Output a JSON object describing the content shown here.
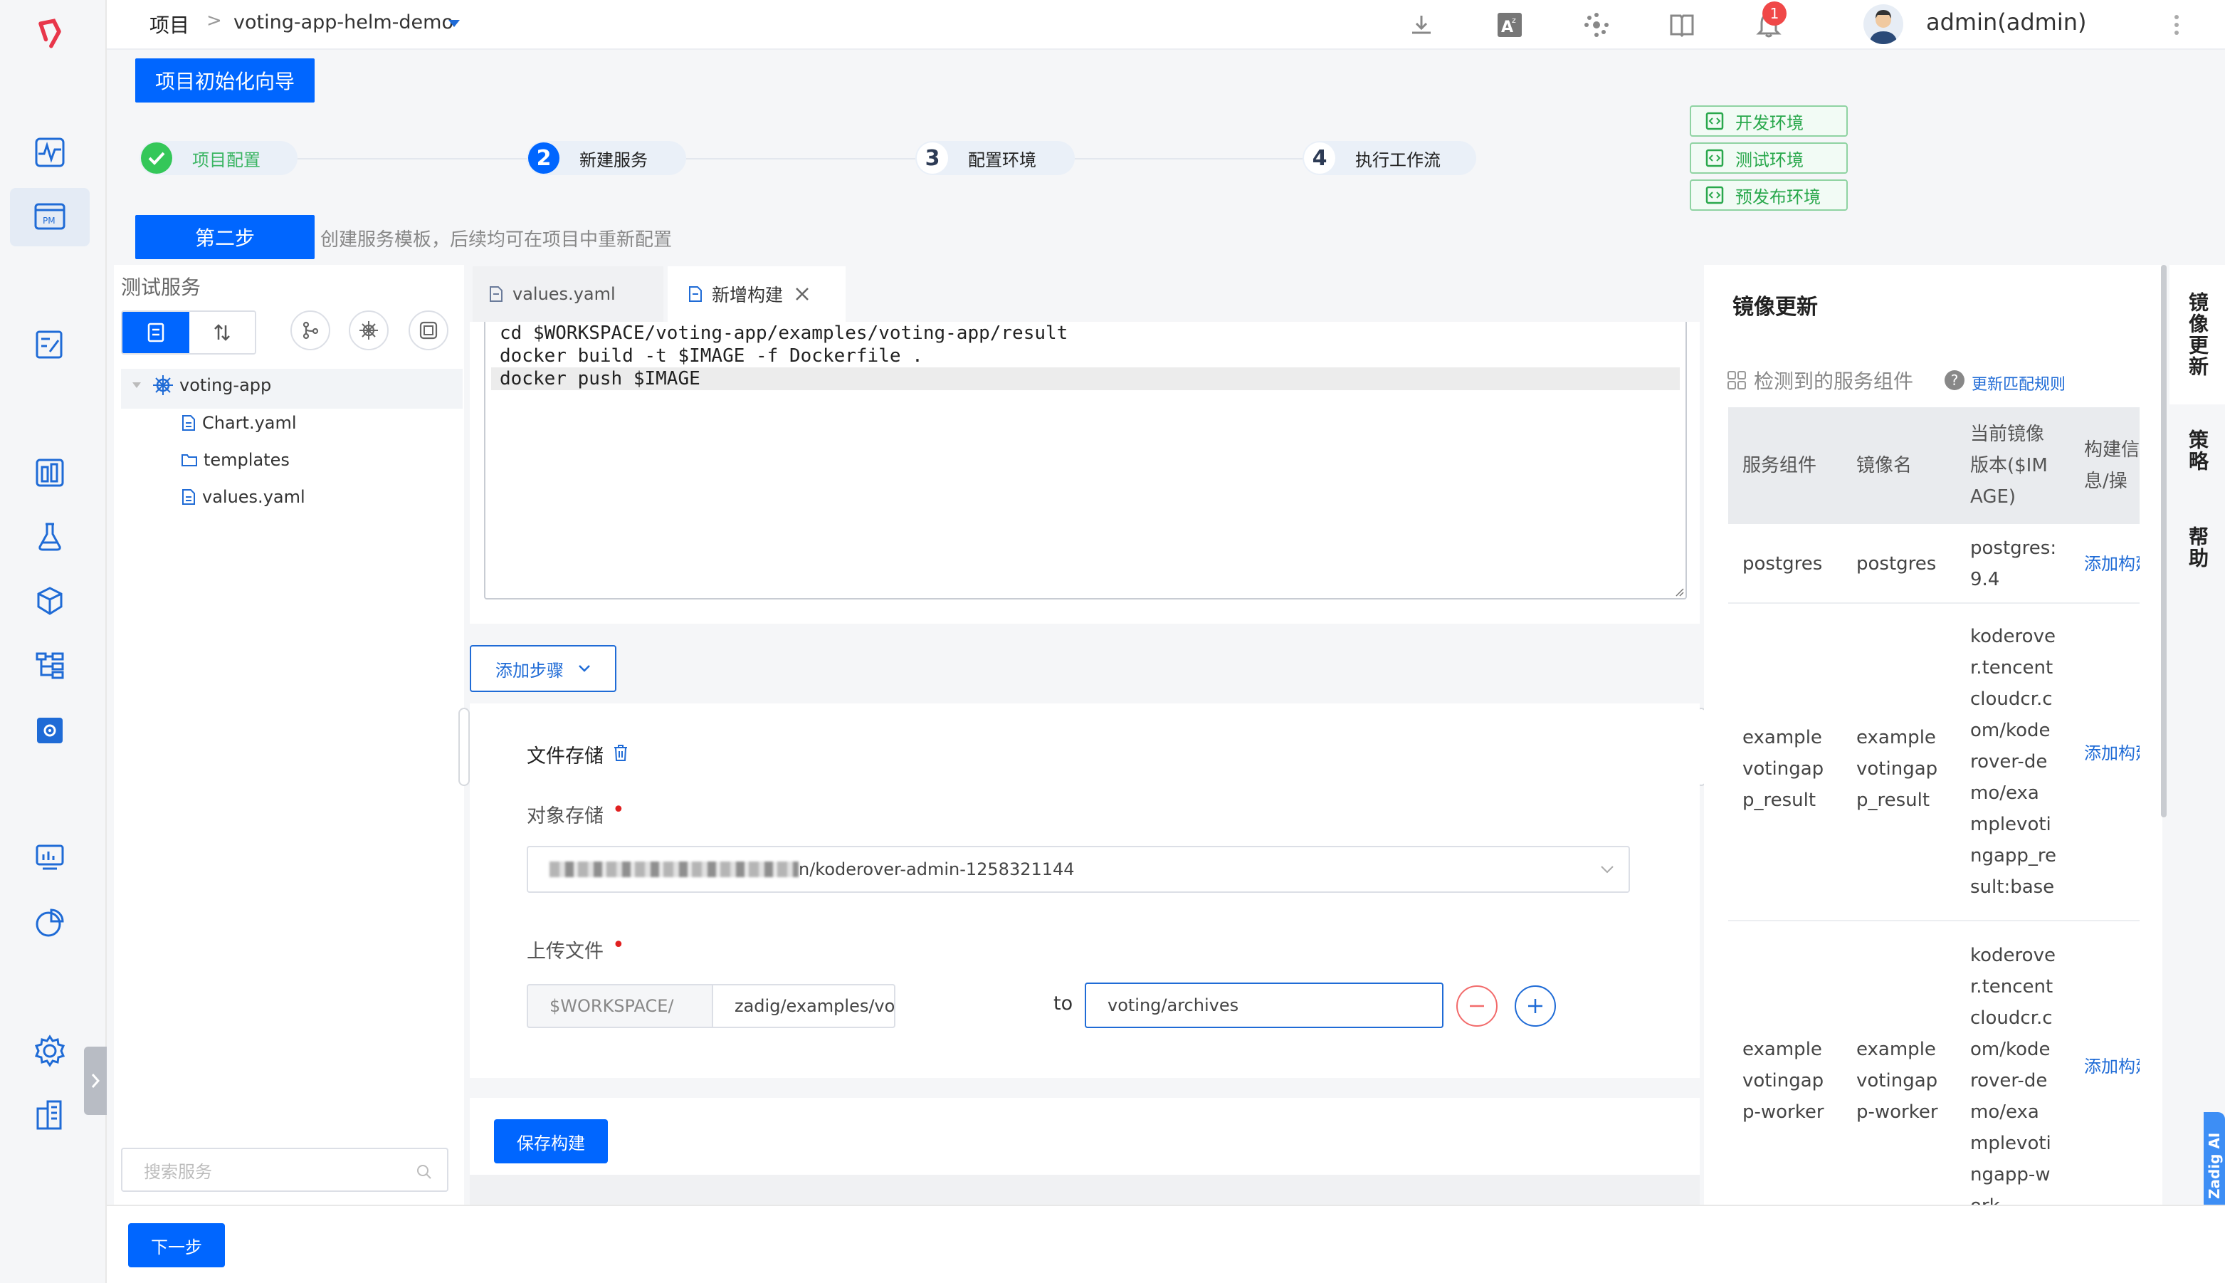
{
  "header": {
    "breadcrumb_root": "项目",
    "breadcrumb_sep": ">",
    "project_name": "voting-app-helm-demo",
    "notification_count": "1",
    "user": "admin(admin)"
  },
  "wizard": {
    "title_button": "项目初始化向导",
    "steps": [
      {
        "num": "1",
        "label": "项目配置",
        "state": "done"
      },
      {
        "num": "2",
        "label": "新建服务",
        "state": "active"
      },
      {
        "num": "3",
        "label": "配置环境",
        "state": "pending"
      },
      {
        "num": "4",
        "label": "执行工作流",
        "state": "pending"
      }
    ],
    "current_step_label": "第二步",
    "current_step_desc": "创建服务模板，后续均可在项目中重新配置",
    "envs": [
      "开发环境",
      "测试环境",
      "预发布环境"
    ]
  },
  "service_panel": {
    "title": "测试服务",
    "tree": [
      {
        "name": "voting-app",
        "type": "service"
      },
      {
        "name": "Chart.yaml",
        "type": "file"
      },
      {
        "name": "templates",
        "type": "folder"
      },
      {
        "name": "values.yaml",
        "type": "file"
      }
    ],
    "search_placeholder": "搜索服务"
  },
  "editor": {
    "tabs": [
      {
        "label": "values.yaml",
        "active": false
      },
      {
        "label": "新增构建",
        "active": true
      }
    ],
    "code_lines": [
      "cd $WORKSPACE/voting-app/examples/voting-app/result",
      "docker build -t $IMAGE -f Dockerfile .",
      "docker push $IMAGE"
    ],
    "add_step_button": "添加步骤",
    "file_storage": {
      "title": "文件存储",
      "object_storage_label": "对象存储",
      "object_storage_value": "n/koderover-admin-1258321144",
      "upload_label": "上传文件",
      "workspace_prefix": "$WORKSPACE/",
      "source_path": "zadig/examples/voting-app/result",
      "to_label": "to",
      "dest_path": "voting/archives"
    },
    "save_button": "保存构建"
  },
  "image_update": {
    "title": "镜像更新",
    "detected_label": "检测到的服务组件",
    "update_rules_link": "更新匹配规则",
    "columns": [
      "服务组件",
      "镜像名",
      "当前镜像版本($IMAGE)",
      "构建信息/操作"
    ],
    "rows": [
      {
        "component": "postgres",
        "image": "postgres",
        "version": "postgres:9.4",
        "action": "添加构建"
      },
      {
        "component": "examplevotingapp_result",
        "image": "examplevotingapp_result",
        "version": "koderover.tencentcloudcr.com/koderover-demo/examplevotingapp_result:base",
        "action": "添加构建"
      },
      {
        "component": "examplevotingapp-worker",
        "image": "examplevotingapp-worker",
        "version": "koderover.tencentcloudcr.com/koderover-demo/examplevotingapp-work",
        "action": "添加构建"
      }
    ]
  },
  "side_tabs": [
    "镜像更新",
    "策略",
    "帮助"
  ],
  "ai_badge": "Zadig AI",
  "footer": {
    "next_button": "下一步"
  },
  "colors": {
    "primary": "#0066ff",
    "success": "#29a84c",
    "danger": "#e02020"
  }
}
